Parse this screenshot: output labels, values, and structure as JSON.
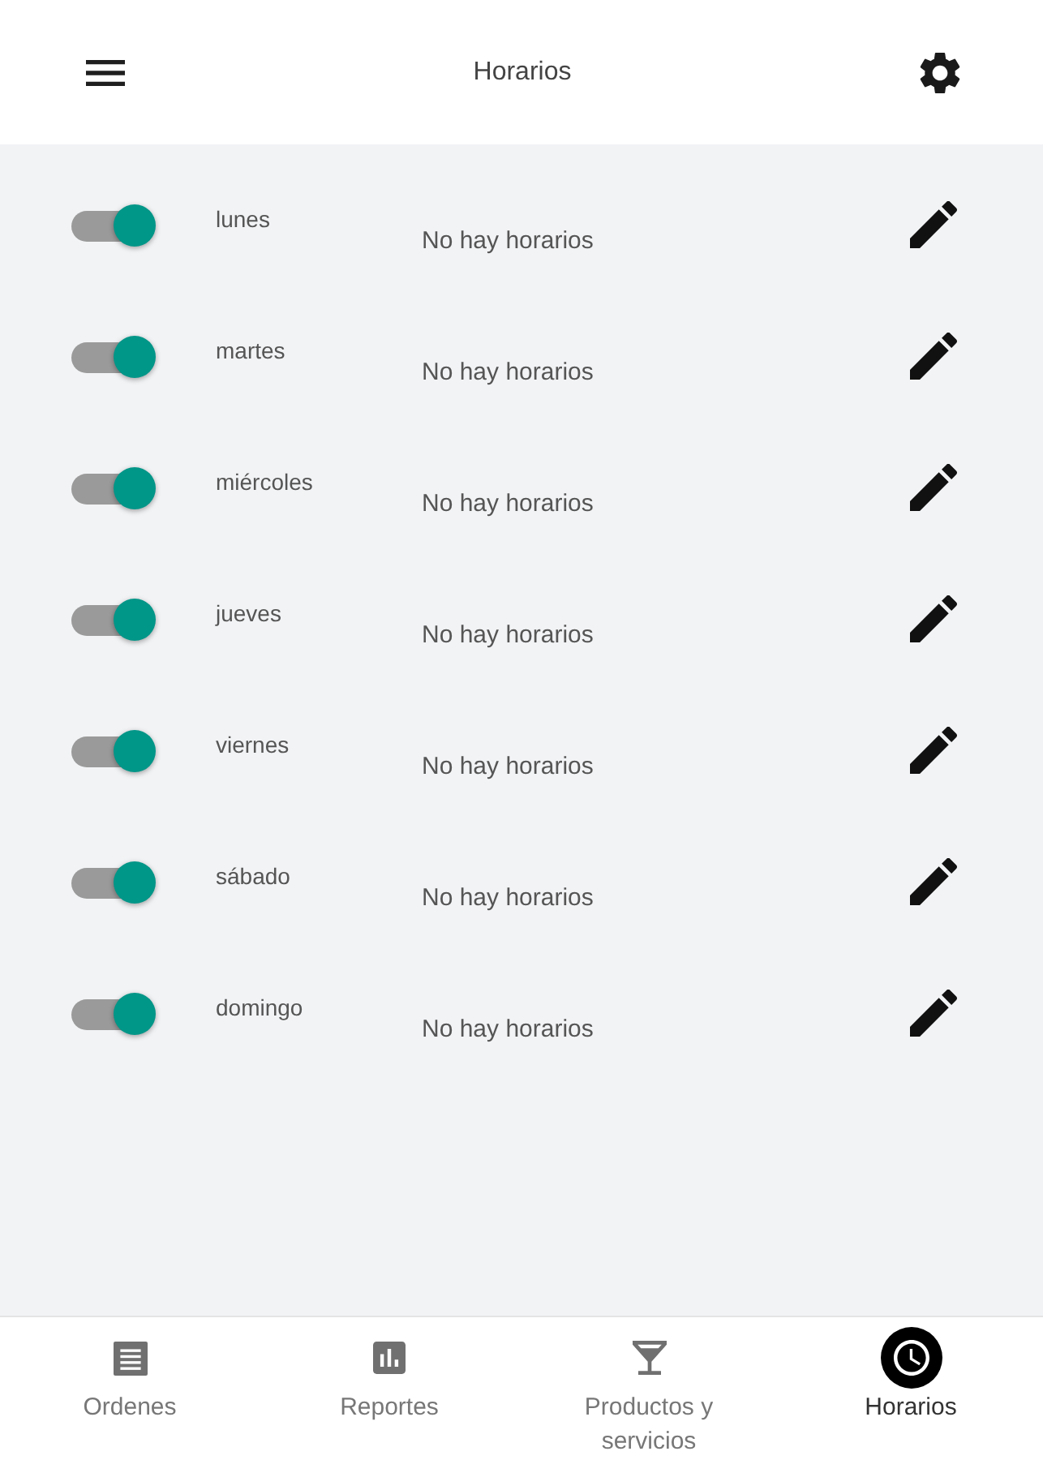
{
  "header": {
    "title": "Horarios"
  },
  "days": [
    {
      "name": "lunes",
      "on": true,
      "summary": "No hay horarios"
    },
    {
      "name": "martes",
      "on": true,
      "summary": "No hay horarios"
    },
    {
      "name": "miércoles",
      "on": true,
      "summary": "No hay horarios"
    },
    {
      "name": "jueves",
      "on": true,
      "summary": "No hay horarios"
    },
    {
      "name": "viernes",
      "on": true,
      "summary": "No hay horarios"
    },
    {
      "name": "sábado",
      "on": true,
      "summary": "No hay horarios"
    },
    {
      "name": "domingo",
      "on": true,
      "summary": "No hay horarios"
    }
  ],
  "bottom_nav": [
    {
      "label": "Ordenes",
      "selected": false
    },
    {
      "label": "Reportes",
      "selected": false
    },
    {
      "label": "Productos y servicios",
      "selected": false
    },
    {
      "label": "Horarios",
      "selected": true
    }
  ]
}
